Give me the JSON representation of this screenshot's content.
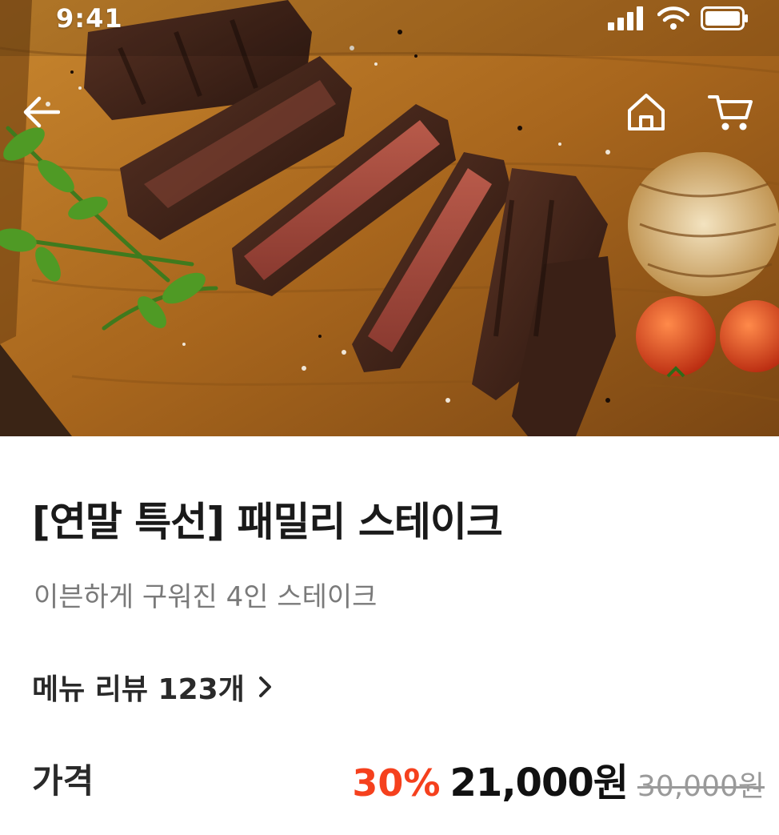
{
  "status_bar": {
    "time": "9:41"
  },
  "nav": {
    "back_icon": "arrow-left-icon",
    "home_icon": "home-icon",
    "cart_icon": "cart-icon"
  },
  "hero": {
    "image": "steak-on-wooden-board"
  },
  "product": {
    "title": "[연말 특선] 패밀리 스테이크",
    "subtitle": "이븐하게 구워진 4인 스테이크"
  },
  "reviews": {
    "label": "메뉴 리뷰 123개",
    "chevron_icon": "chevron-right-icon"
  },
  "price": {
    "label": "가격",
    "discount": "30%",
    "sale_price": "21,000원",
    "original_price": "30,000원"
  },
  "colors": {
    "discount": "#f5401d",
    "title": "#1a1a1a",
    "subtitle": "#7a7a7a",
    "strikethrough": "#9a9a9a"
  }
}
